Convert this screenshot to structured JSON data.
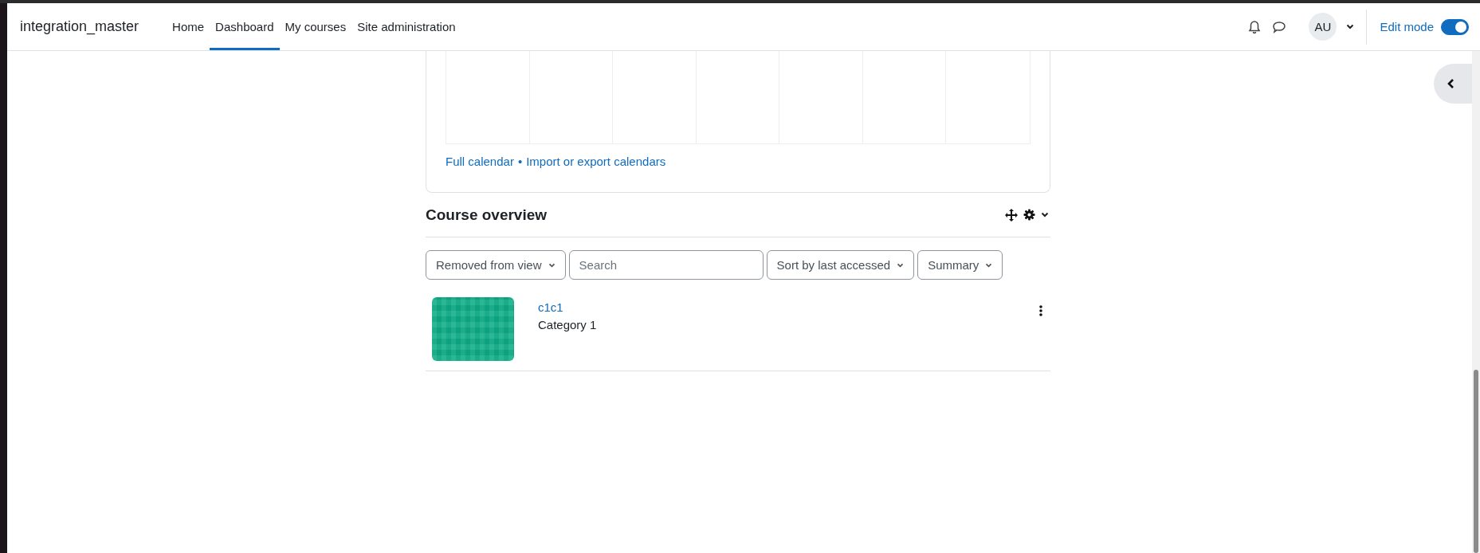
{
  "navbar": {
    "site_name": "integration_master",
    "tabs": [
      {
        "label": "Home",
        "selected": false
      },
      {
        "label": "Dashboard",
        "selected": true
      },
      {
        "label": "My courses",
        "selected": false
      },
      {
        "label": "Site administration",
        "selected": false
      }
    ],
    "user_initials": "AU",
    "edit_mode": {
      "label": "Edit mode",
      "on": true
    }
  },
  "calendar": {
    "links": [
      "Full calendar",
      "Import or export calendars"
    ],
    "separator": "•"
  },
  "course_overview": {
    "title": "Course overview",
    "filters": [
      {
        "kind": "dropdown",
        "label": "Removed from view"
      },
      {
        "kind": "search",
        "placeholder": "Search"
      },
      {
        "kind": "dropdown",
        "label": "Sort by last accessed"
      },
      {
        "kind": "dropdown",
        "label": "Summary"
      }
    ],
    "courses": [
      {
        "name": "c1c1",
        "category": "Category 1"
      }
    ]
  }
}
